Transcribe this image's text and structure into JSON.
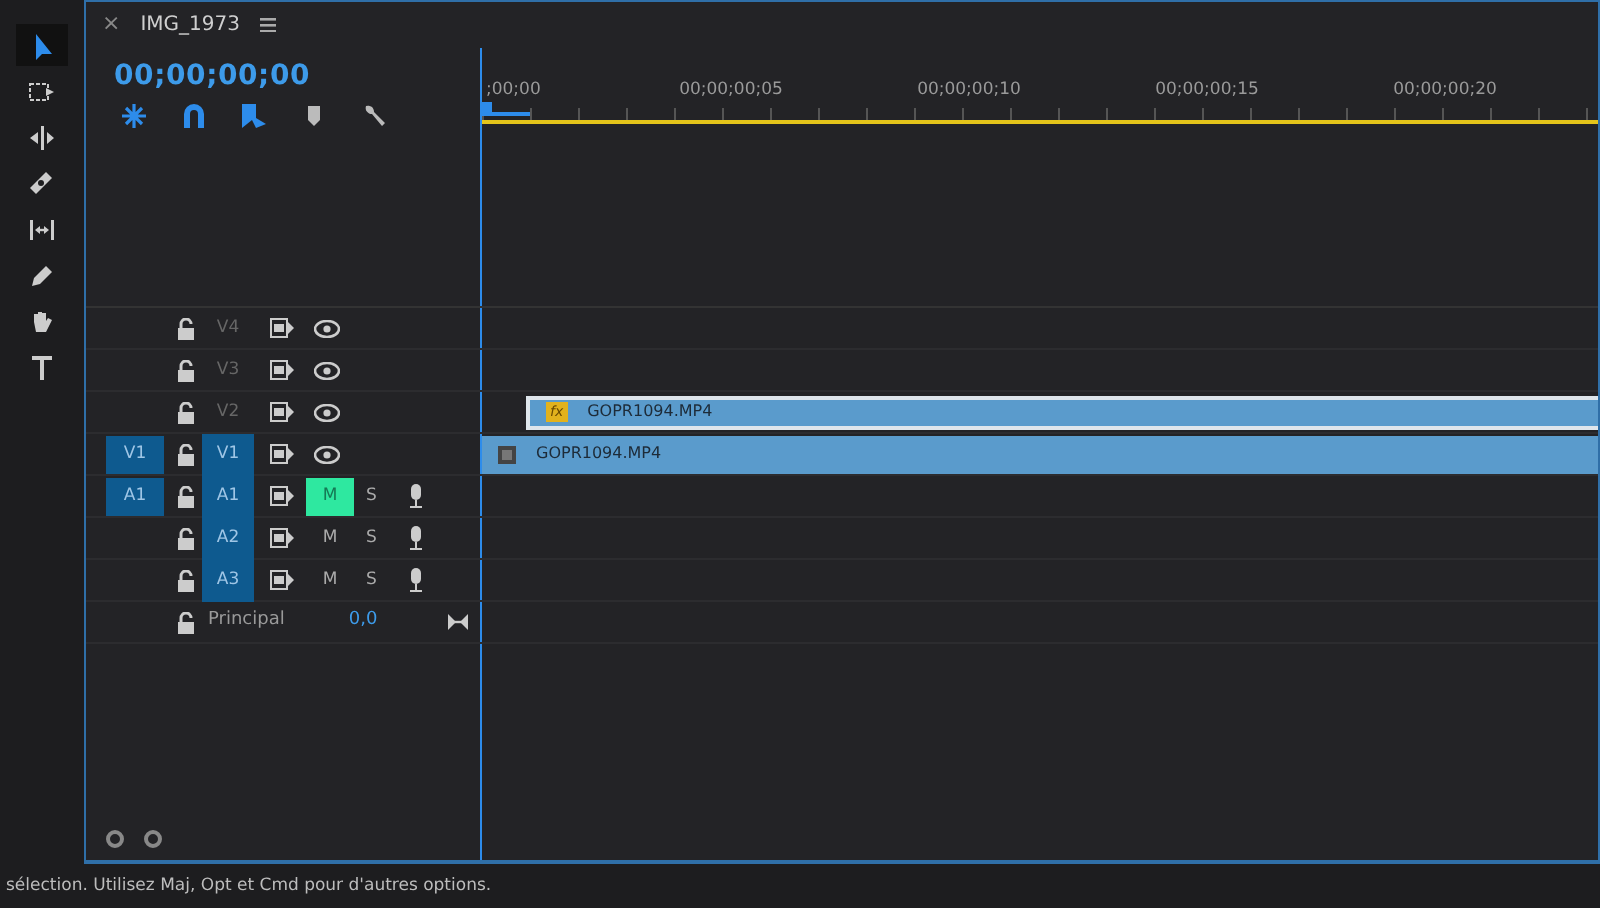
{
  "tools": [
    {
      "kind": "select",
      "selected": true
    },
    {
      "kind": "track",
      "selected": false
    },
    {
      "kind": "ripple",
      "selected": false
    },
    {
      "kind": "razor",
      "selected": false
    },
    {
      "kind": "slip",
      "selected": false
    },
    {
      "kind": "pen",
      "selected": false
    },
    {
      "kind": "hand",
      "selected": false
    },
    {
      "kind": "type",
      "selected": false
    }
  ],
  "sequence_tab": {
    "close": "×",
    "title": "IMG_1973"
  },
  "timecode": "00;00;00;00",
  "timeline_toggles": [
    {
      "kind": "nest",
      "on": true
    },
    {
      "kind": "snap",
      "on": true
    },
    {
      "kind": "linked",
      "on": true
    },
    {
      "kind": "marker",
      "on": false
    },
    {
      "kind": "settings",
      "on": false
    }
  ],
  "ruler_labels": [
    ";00;00",
    "00;00;00;05",
    "00;00;00;10",
    "00;00;00;15",
    "00;00;00;20"
  ],
  "tracks": [
    {
      "kind": "video",
      "target": "V4",
      "target_selected": false
    },
    {
      "kind": "video",
      "target": "V3",
      "target_selected": false
    },
    {
      "kind": "video",
      "target": "V2",
      "target_selected": false,
      "clip": {
        "name": "GOPR1094.MP4",
        "kind": "dragged",
        "fx": "fx"
      }
    },
    {
      "kind": "video",
      "source": "V1",
      "source_selected": true,
      "target": "V1",
      "target_selected": true,
      "clip": {
        "name": "GOPR1094.MP4",
        "kind": "placed"
      }
    },
    {
      "kind": "audio",
      "source": "A1",
      "source_selected": true,
      "target": "A1",
      "target_selected": true,
      "mute": "M",
      "muted": true,
      "solo": "S"
    },
    {
      "kind": "audio",
      "target": "A2",
      "target_selected": true,
      "mute": "M",
      "muted": false,
      "solo": "S"
    },
    {
      "kind": "audio",
      "target": "A3",
      "target_selected": true,
      "mute": "M",
      "muted": false,
      "solo": "S"
    },
    {
      "kind": "master",
      "name": "Principal",
      "value": "0,0"
    }
  ],
  "status_bar": "sélection. Utilisez Maj, Opt et Cmd pour d'autres options."
}
